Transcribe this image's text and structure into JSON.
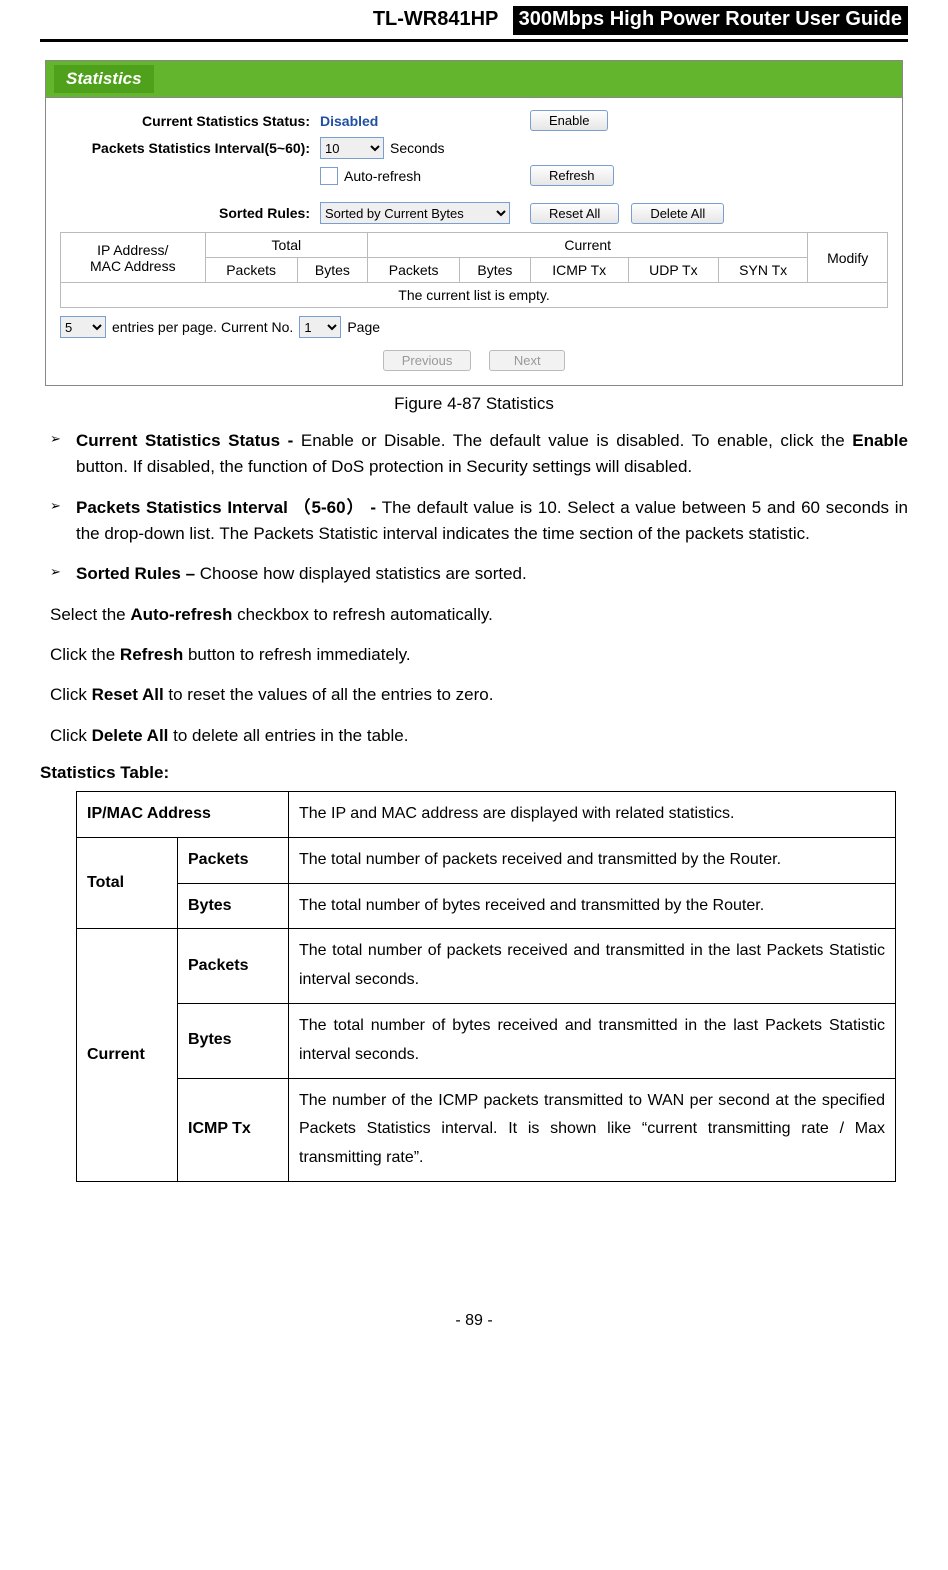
{
  "header": {
    "model": "TL-WR841HP",
    "title": "300Mbps High Power Router User Guide"
  },
  "ui": {
    "panel_title": "Statistics",
    "labels": {
      "status": "Current Statistics Status:",
      "interval": "Packets Statistics Interval(5~60):",
      "sorted": "Sorted Rules:"
    },
    "values": {
      "status": "Disabled",
      "interval": "10",
      "seconds": "Seconds",
      "auto_refresh": "Auto-refresh",
      "sorted_option": "Sorted by Current Bytes"
    },
    "buttons": {
      "enable": "Enable",
      "refresh": "Refresh",
      "reset_all": "Reset All",
      "delete_all": "Delete All",
      "previous": "Previous",
      "next": "Next"
    },
    "table_headers": {
      "ip_mac": "IP Address/\nMAC Address",
      "total": "Total",
      "current": "Current",
      "packets": "Packets",
      "bytes": "Bytes",
      "icmp": "ICMP Tx",
      "udp": "UDP Tx",
      "syn": "SYN Tx",
      "modify": "Modify",
      "empty": "The current list is empty."
    },
    "pager": {
      "entries_value": "5",
      "entries_text": "entries per page.   Current No.",
      "page_value": "1",
      "page_text": "Page"
    }
  },
  "caption": "Figure 4-87    Statistics",
  "bullets": [
    {
      "b": "Current Statistics Status -",
      "t": " Enable or Disable. The default value is disabled. To enable, click the ",
      "b2": "Enable",
      "t2": " button. If disabled, the function of DoS protection in Security settings will disabled."
    },
    {
      "b": "Packets Statistics Interval ",
      "m": "（5-60）",
      "b3": " -",
      "t": " The default value is 10. Select a value between 5 and 60 seconds in the drop-down list. The Packets Statistic interval indicates the time section of the packets statistic."
    },
    {
      "b": "Sorted Rules –",
      "t": " Choose how displayed statistics are sorted."
    }
  ],
  "paras": {
    "p1a": "Select the ",
    "p1b": "Auto-refresh",
    "p1c": " checkbox to refresh automatically.",
    "p2a": "Click the ",
    "p2b": "Refresh",
    "p2c": " button to refresh immediately.",
    "p3a": "Click ",
    "p3b": "Reset All",
    "p3c": " to reset the values of all the entries to zero.",
    "p4a": "Click ",
    "p4b": "Delete All",
    "p4c": " to delete all entries in the table."
  },
  "table_heading": "Statistics Table:",
  "doc_table": {
    "r1c1": "IP/MAC Address",
    "r1c2": "The IP and MAC address are displayed with related statistics.",
    "total": "Total",
    "packets": "Packets",
    "bytes": "Bytes",
    "total_packets": "The total number of packets received and transmitted by the Router.",
    "total_bytes": "The total number of bytes received and transmitted by the Router.",
    "current": "Current",
    "cur_packets": "The total number of packets received and transmitted in the last Packets Statistic interval seconds.",
    "cur_bytes": "The total number of bytes received and transmitted in the last Packets Statistic interval seconds.",
    "icmp": "ICMP Tx",
    "cur_icmp": "The number of the ICMP packets transmitted to WAN per second at the specified Packets Statistics interval. It is shown like “current transmitting rate / Max transmitting rate”."
  },
  "footer": "- 89 -"
}
